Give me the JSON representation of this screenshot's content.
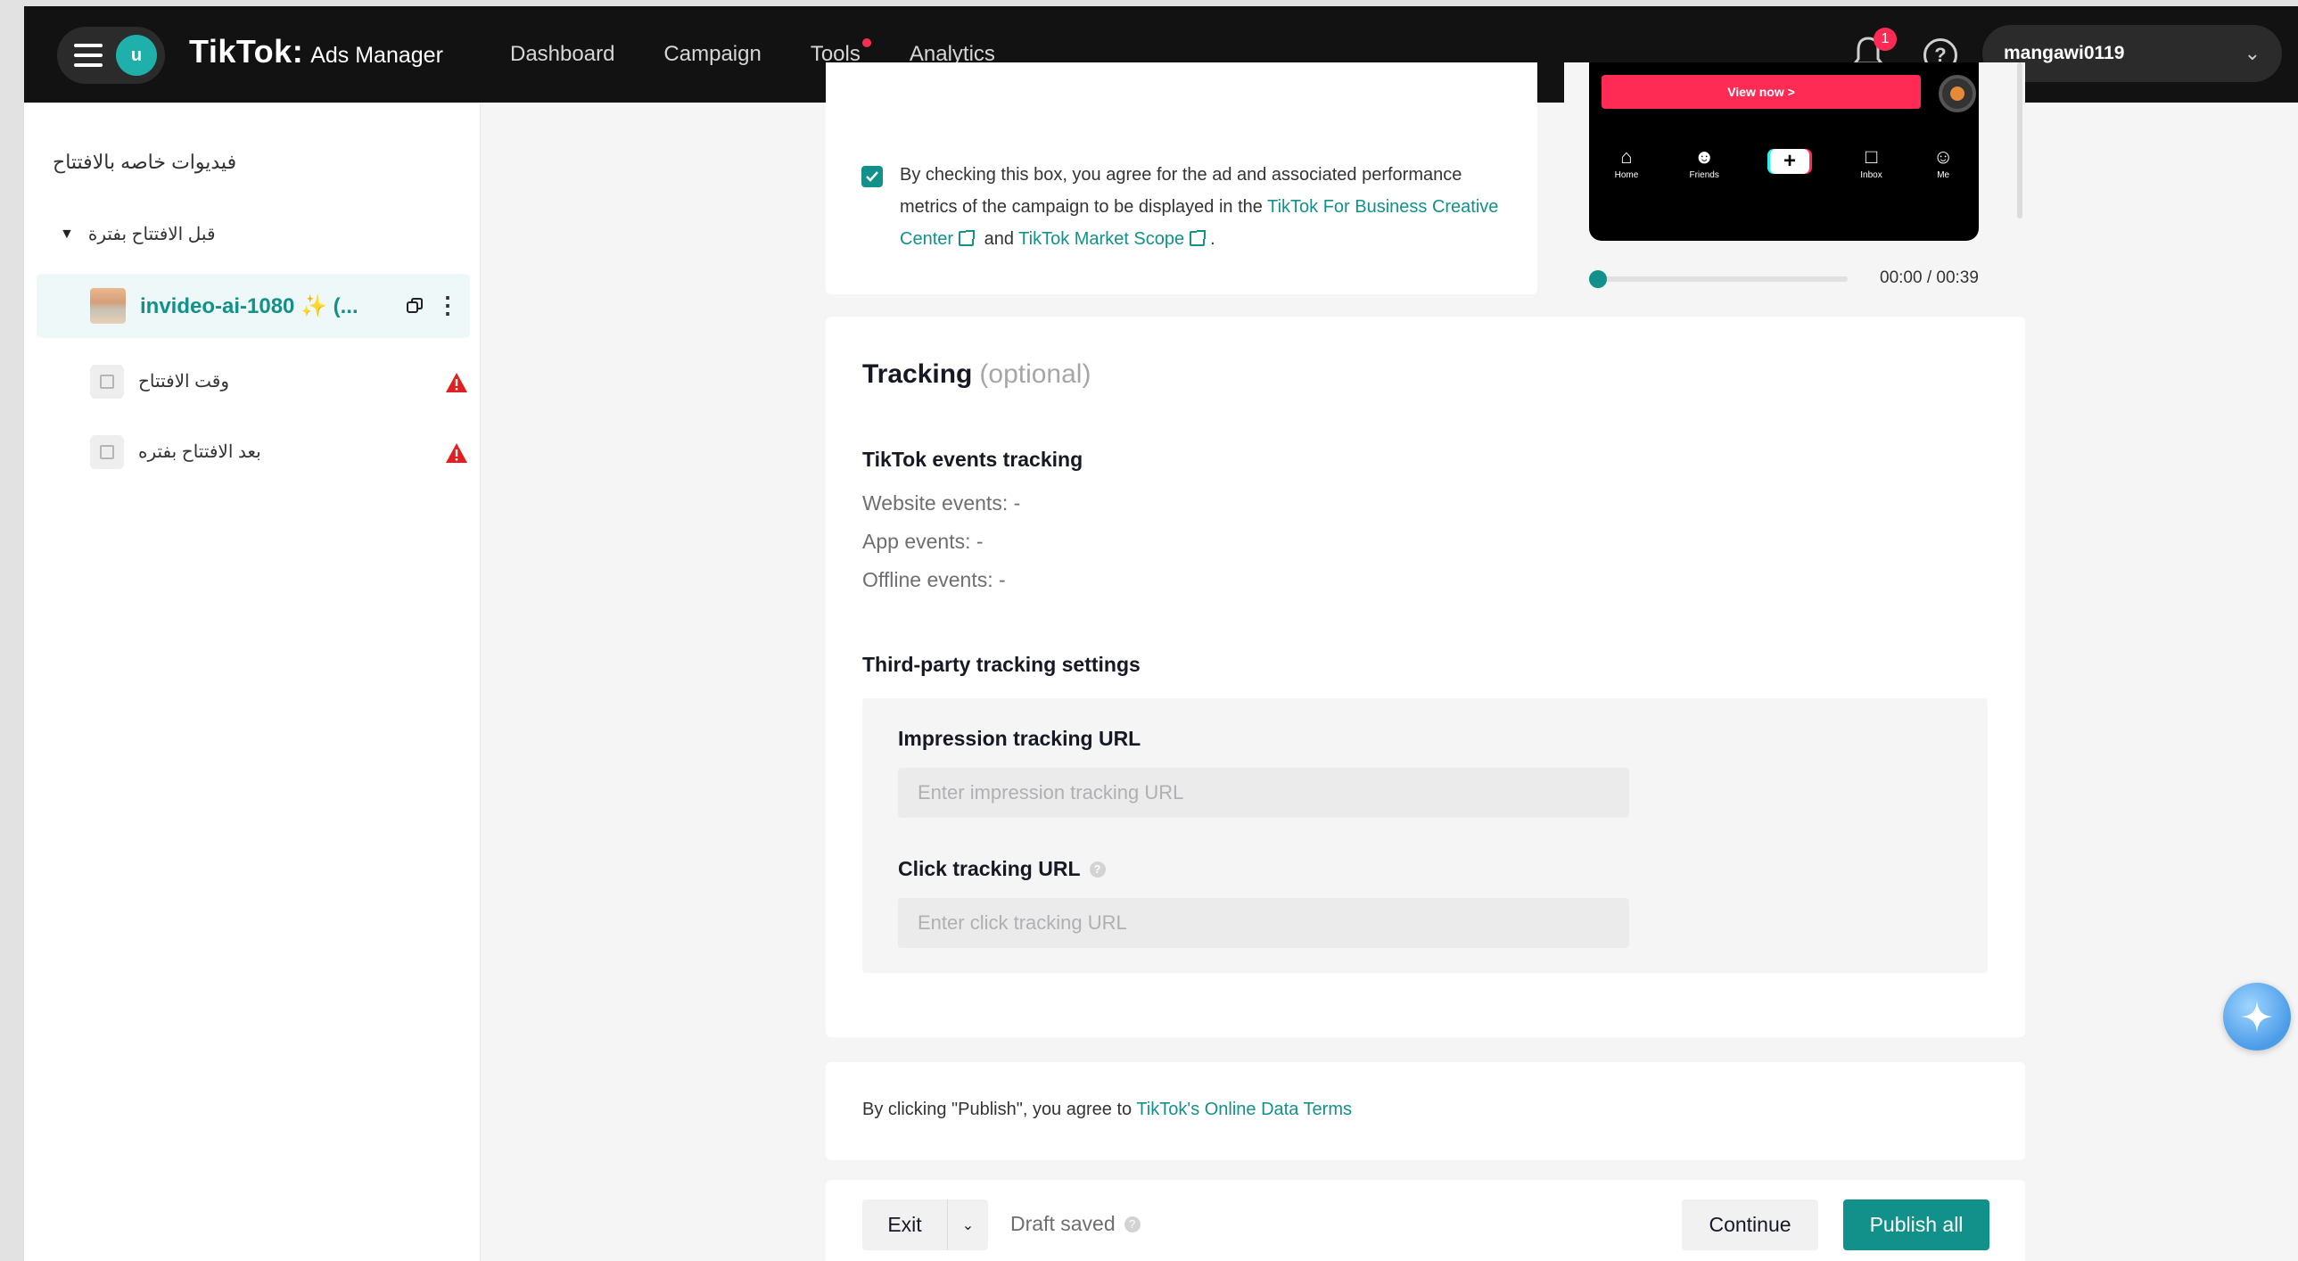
{
  "topbar": {
    "avatar_initial": "u",
    "brand": "TikTok",
    "brand_sep": ":",
    "brand_sub": "Ads Manager",
    "nav": [
      "Dashboard",
      "Campaign",
      "Tools",
      "Analytics"
    ],
    "notification_count": "1",
    "help_glyph": "?",
    "account_name": "mangawi0119"
  },
  "sidebar": {
    "title": "فيديوات خاصه بالافتتاح",
    "group_label": "قبل الافتتاح بفترة",
    "active_item": "invideo-ai-1080 ✨ (...",
    "items": [
      {
        "label": "وقت الافتتاح",
        "status": "warning"
      },
      {
        "label": "بعد الافتتاح بفتره",
        "status": "warning"
      }
    ]
  },
  "agreement": {
    "checked": true,
    "text_before": "By checking this box, you agree for the ad and associated performance metrics of the campaign to be displayed in the ",
    "link1": "TikTok For Business Creative Center",
    "text_mid": " and ",
    "link2": "TikTok Market Scope",
    "text_end": "."
  },
  "preview": {
    "cta": "View now >",
    "tabs": [
      "Home",
      "Friends",
      "",
      "Inbox",
      "Me"
    ],
    "time": "00:00 / 00:39",
    "progress": 0
  },
  "tracking": {
    "title": "Tracking",
    "optional": "(optional)",
    "events_heading": "TikTok events tracking",
    "website_events": "Website events: -",
    "app_events": "App events: -",
    "offline_events": "Offline events: -",
    "third_party_heading": "Third-party tracking settings",
    "impression_label": "Impression tracking URL",
    "impression_placeholder": "Enter impression tracking URL",
    "click_label": "Click tracking URL",
    "click_placeholder": "Enter click tracking URL"
  },
  "terms": {
    "text": "By clicking \"Publish\", you agree to ",
    "link": "TikTok's Online Data Terms"
  },
  "footer": {
    "exit": "Exit",
    "draft_status": "Draft saved",
    "continue": "Continue",
    "publish_all": "Publish all"
  },
  "colors": {
    "accent": "#12918a",
    "topbar": "#121212",
    "notification": "#fe2c55",
    "warning": "#e02020"
  }
}
